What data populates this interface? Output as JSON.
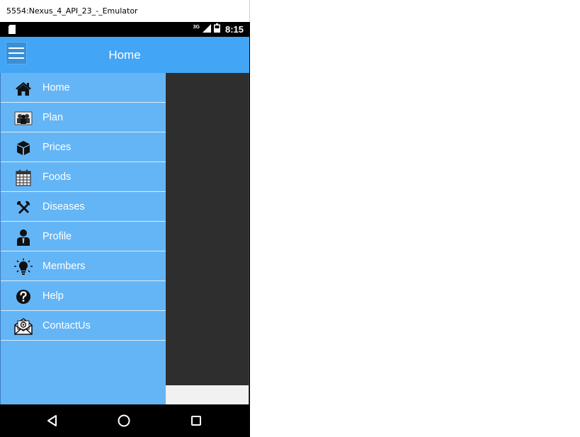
{
  "window": {
    "title": "5554:Nexus_4_API_23_-_Emulator"
  },
  "status_bar": {
    "network": "3G",
    "time": "8:15",
    "icons": [
      "sd-card-icon",
      "signal-icon",
      "battery-icon"
    ]
  },
  "app_bar": {
    "title": "Home",
    "color": "#42A5F5",
    "menu_icon": "hamburger-icon"
  },
  "drawer": {
    "color": "#64B5F6",
    "items": [
      {
        "label": "Home",
        "icon": "home-icon"
      },
      {
        "label": "Plan",
        "icon": "people-icon"
      },
      {
        "label": "Prices",
        "icon": "box-icon"
      },
      {
        "label": "Foods",
        "icon": "calendar-icon"
      },
      {
        "label": "Diseases",
        "icon": "tools-icon"
      },
      {
        "label": "Profile",
        "icon": "person-icon"
      },
      {
        "label": "Members",
        "icon": "lightbulb-icon"
      },
      {
        "label": "Help",
        "icon": "help-icon"
      },
      {
        "label": "ContactUs",
        "icon": "mail-icon"
      }
    ]
  },
  "nav_bar": {
    "buttons": [
      "back-icon",
      "home-circle-icon",
      "recents-icon"
    ]
  }
}
